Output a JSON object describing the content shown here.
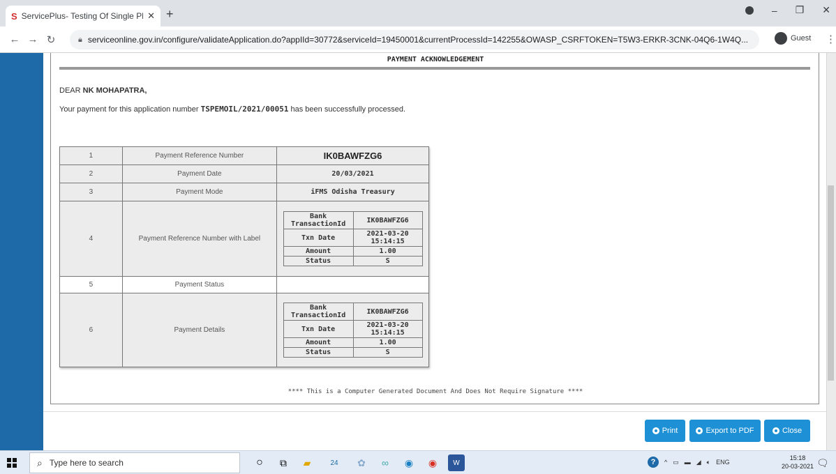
{
  "browser": {
    "tab_title": "ServicePlus- Testing Of Single Ph",
    "tab_close": "✕",
    "new_tab": "+",
    "url": "serviceonline.gov.in/configure/validateApplication.do?appIId=30772&serviceId=19450001&currentProcessId=142255&OWASP_CSRFTOKEN=T5W3-ERKR-3CNK-04Q6-1W4Q...",
    "profile_label": "Guest"
  },
  "page": {
    "heading": "PAYMENT ACKNOWLEDGEMENT",
    "salutation_prefix": "DEAR",
    "salutation_name": "NK MOHAPATRA,",
    "message_prefix": "Your payment for this application number",
    "application_number": "TSPEMOIL/2021/00051",
    "message_suffix": "has been successfully processed.",
    "footnote": "**** This is a Computer Generated Document And Does Not Require Signature ****"
  },
  "table": {
    "rows": [
      {
        "num": "1",
        "label": "Payment Reference Number",
        "value": "IK0BAWFZG6"
      },
      {
        "num": "2",
        "label": "Payment Date",
        "value": "20/03/2021"
      },
      {
        "num": "3",
        "label": "Payment Mode",
        "value": "iFMS Odisha Treasury"
      },
      {
        "num": "4",
        "label": "Payment Reference Number with Label",
        "details": {
          "bank_label": "Bank TransactionId",
          "bank_value": "IK0BAWFZG6",
          "date_label": "Txn Date",
          "date_value": "2021-03-20 15:14:15",
          "amount_label": "Amount",
          "amount_value": "1.00",
          "status_label": "Status",
          "status_value": "S"
        }
      },
      {
        "num": "5",
        "label": "Payment Status",
        "value": ""
      },
      {
        "num": "6",
        "label": "Payment Details",
        "details": {
          "bank_label": "Bank TransactionId",
          "bank_value": "IK0BAWFZG6",
          "date_label": "Txn Date",
          "date_value": "2021-03-20 15:14:15",
          "amount_label": "Amount",
          "amount_value": "1.00",
          "status_label": "Status",
          "status_value": "S"
        }
      }
    ]
  },
  "buttons": {
    "print": "Print",
    "export_pdf": "Export to PDF",
    "close": "Close"
  },
  "taskbar": {
    "search_placeholder": "Type here to search",
    "mail_badge": "24",
    "language": "ENG",
    "time": "15:18",
    "date": "20-03-2021"
  },
  "colors": {
    "accent": "#1e90d6",
    "side_band": "#1e6aa8"
  }
}
